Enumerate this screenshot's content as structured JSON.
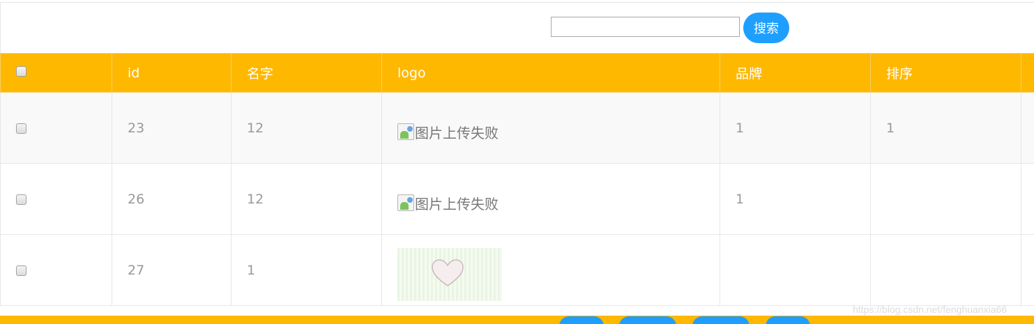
{
  "search": {
    "value": "",
    "placeholder": "",
    "button_label": "搜索"
  },
  "table": {
    "columns": [
      "id",
      "名字",
      "logo",
      "品牌",
      "排序",
      ""
    ],
    "rows": [
      {
        "id": "23",
        "name": "12",
        "logo_alt": "图片上传失败",
        "brand": "1",
        "sort": "1"
      },
      {
        "id": "26",
        "name": "12",
        "logo_alt": "图片上传失败",
        "brand": "1",
        "sort": ""
      },
      {
        "id": "27",
        "name": "1",
        "logo_alt": "",
        "brand": "",
        "sort": ""
      }
    ]
  },
  "watermark": "https://blog.csdn.net/fenghuanxia66",
  "colors": {
    "header": "#ffb800",
    "accent": "#1e9fff",
    "row_alt": "#f9f9f9",
    "border": "#e6e6e6"
  },
  "icons": {
    "broken": "broken-image-icon",
    "photo": "heart-photo"
  }
}
